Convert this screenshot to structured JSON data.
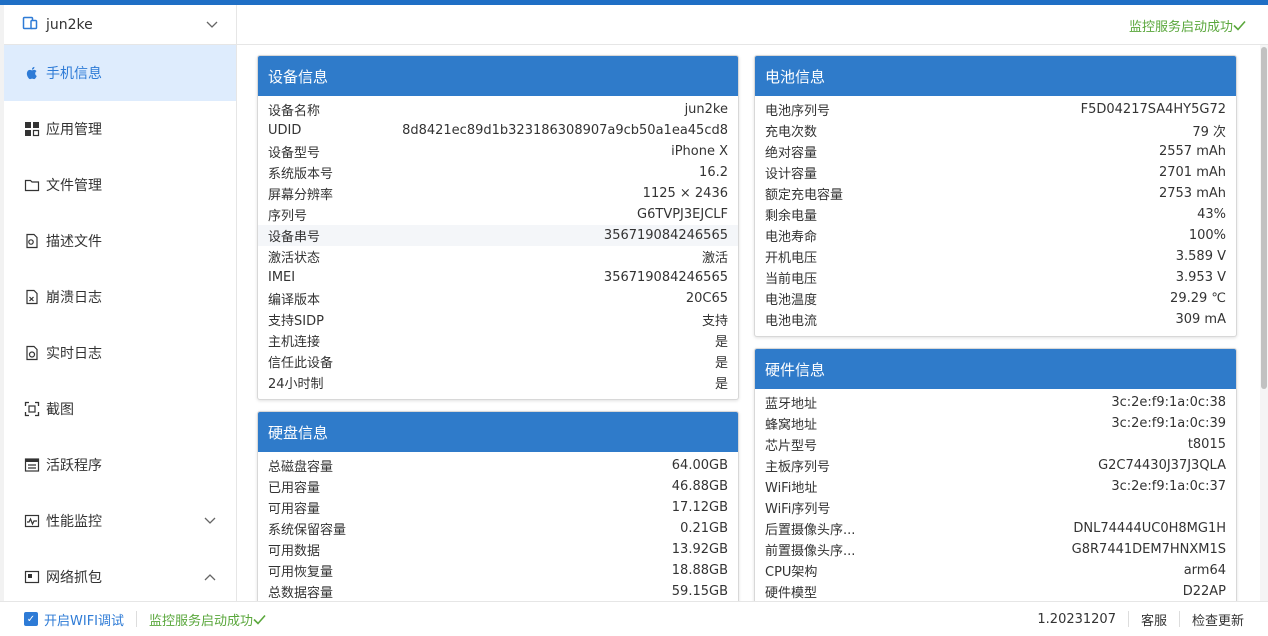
{
  "device": {
    "name": "jun2ke"
  },
  "nav": [
    {
      "label": "手机信息",
      "icon": "apple-icon",
      "active": true
    },
    {
      "label": "应用管理",
      "icon": "apps-icon"
    },
    {
      "label": "文件管理",
      "icon": "folder-icon"
    },
    {
      "label": "描述文件",
      "icon": "profile-icon"
    },
    {
      "label": "崩溃日志",
      "icon": "crash-log-icon"
    },
    {
      "label": "实时日志",
      "icon": "realtime-log-icon"
    },
    {
      "label": "截图",
      "icon": "screenshot-icon"
    },
    {
      "label": "活跃程序",
      "icon": "active-app-icon"
    },
    {
      "label": "性能监控",
      "icon": "performance-icon",
      "chevron": "down"
    },
    {
      "label": "网络抓包",
      "icon": "network-capture-icon",
      "chevron": "up"
    }
  ],
  "status": {
    "monitor": "监控服务启动成功"
  },
  "cards": {
    "device_info": {
      "title": "设备信息",
      "rows": [
        {
          "k": "设备名称",
          "v": "jun2ke"
        },
        {
          "k": "UDID",
          "v": "8d8421ec89d1b323186308907a9cb50a1ea45cd8"
        },
        {
          "k": "设备型号",
          "v": "iPhone X"
        },
        {
          "k": "系统版本号",
          "v": "16.2"
        },
        {
          "k": "屏幕分辨率",
          "v": "1125 × 2436"
        },
        {
          "k": "序列号",
          "v": "G6TVPJ3EJCLF"
        },
        {
          "k": "设备串号",
          "v": "356719084246565"
        },
        {
          "k": "激活状态",
          "v": "激活"
        },
        {
          "k": "IMEI",
          "v": "356719084246565"
        },
        {
          "k": "编译版本",
          "v": "20C65"
        },
        {
          "k": "支持SIDP",
          "v": "支持"
        },
        {
          "k": "主机连接",
          "v": "是"
        },
        {
          "k": "信任此设备",
          "v": "是"
        },
        {
          "k": "24小时制",
          "v": "是"
        }
      ]
    },
    "disk_info": {
      "title": "硬盘信息",
      "rows": [
        {
          "k": "总磁盘容量",
          "v": "64.00GB"
        },
        {
          "k": "已用容量",
          "v": "46.88GB"
        },
        {
          "k": "可用容量",
          "v": "17.12GB"
        },
        {
          "k": "系统保留容量",
          "v": "0.21GB"
        },
        {
          "k": "可用数据",
          "v": "13.92GB"
        },
        {
          "k": "可用恢复量",
          "v": "18.88GB"
        },
        {
          "k": "总数据容量",
          "v": "59.15GB"
        }
      ]
    },
    "battery_info": {
      "title": "电池信息",
      "rows": [
        {
          "k": "电池序列号",
          "v": "F5D04217SA4HY5G72"
        },
        {
          "k": "充电次数",
          "v": "79 次"
        },
        {
          "k": "绝对容量",
          "v": "2557 mAh"
        },
        {
          "k": "设计容量",
          "v": "2701 mAh"
        },
        {
          "k": "额定充电容量",
          "v": "2753 mAh"
        },
        {
          "k": "剩余电量",
          "v": "43%"
        },
        {
          "k": "电池寿命",
          "v": "100%"
        },
        {
          "k": "开机电压",
          "v": "3.589 V"
        },
        {
          "k": "当前电压",
          "v": "3.953 V"
        },
        {
          "k": "电池温度",
          "v": "29.29 ℃"
        },
        {
          "k": "电池电流",
          "v": "309 mA"
        }
      ]
    },
    "hardware_info": {
      "title": "硬件信息",
      "rows": [
        {
          "k": "蓝牙地址",
          "v": "3c:2e:f9:1a:0c:38"
        },
        {
          "k": "蜂窝地址",
          "v": "3c:2e:f9:1a:0c:39"
        },
        {
          "k": "芯片型号",
          "v": "t8015"
        },
        {
          "k": "主板序列号",
          "v": "G2C74430J37J3QLA"
        },
        {
          "k": "WiFi地址",
          "v": "3c:2e:f9:1a:0c:37"
        },
        {
          "k": "WiFi序列号",
          "v": ""
        },
        {
          "k": "后置摄像头序...",
          "v": "DNL74444UC0H8MG1H"
        },
        {
          "k": "前置摄像头序...",
          "v": "G8R7441DEM7HNXM1S"
        },
        {
          "k": "CPU架构",
          "v": "arm64"
        },
        {
          "k": "硬件模型",
          "v": "D22AP"
        }
      ]
    }
  },
  "footer": {
    "wifi_debug": "开启WIFI调试",
    "monitor_status": "监控服务启动成功",
    "version": "1.20231207",
    "support": "客服",
    "check_update": "检查更新"
  },
  "colors": {
    "accent": "#2f7bca",
    "success": "#5aa73c",
    "active_bg": "#deecfd"
  }
}
